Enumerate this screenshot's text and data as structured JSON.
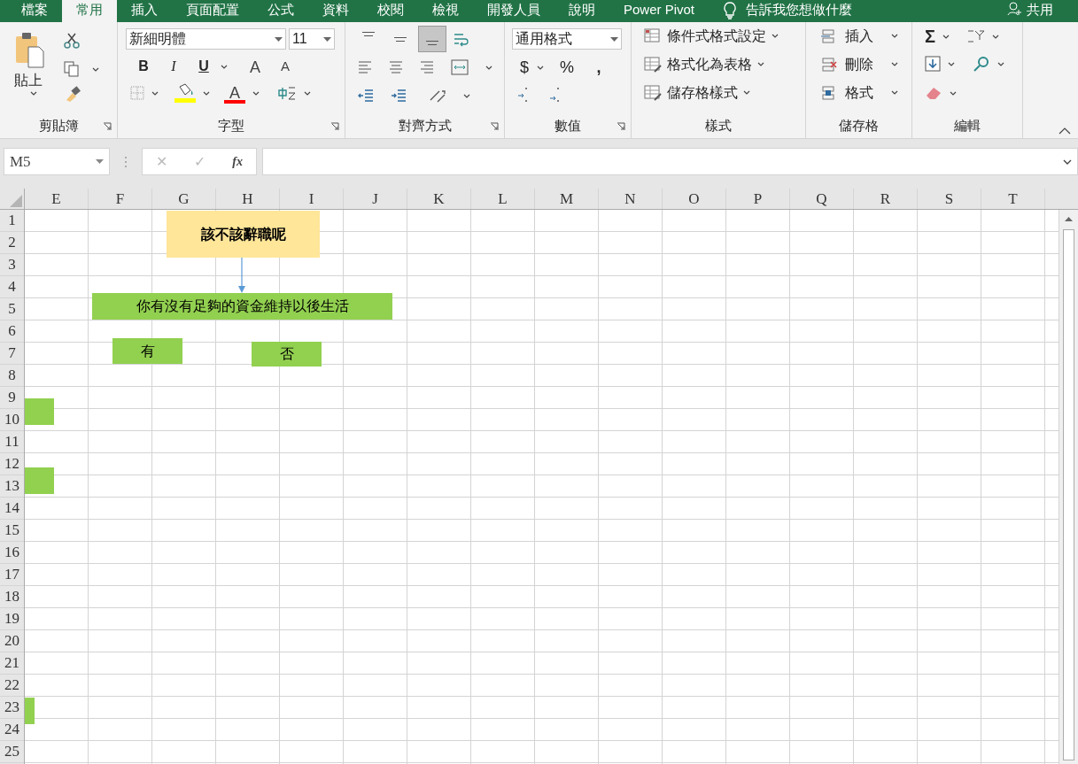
{
  "tabs": [
    {
      "label": "檔案",
      "selected": false
    },
    {
      "label": "常用",
      "selected": true
    },
    {
      "label": "插入",
      "selected": false
    },
    {
      "label": "頁面配置",
      "selected": false
    },
    {
      "label": "公式",
      "selected": false
    },
    {
      "label": "資料",
      "selected": false
    },
    {
      "label": "校閱",
      "selected": false
    },
    {
      "label": "檢視",
      "selected": false
    },
    {
      "label": "開發人員",
      "selected": false
    },
    {
      "label": "說明",
      "selected": false
    },
    {
      "label": "Power Pivot",
      "selected": false
    }
  ],
  "tell_me": "告訴我您想做什麼",
  "share": "共用",
  "ribbon": {
    "clipboard": {
      "paste": "貼上",
      "label": "剪貼簿"
    },
    "font": {
      "name": "新細明體",
      "size": "11",
      "buttons": [
        "B",
        "I",
        "U"
      ],
      "grow": "A",
      "shrink": "A",
      "color_letter": "A",
      "label": "字型"
    },
    "alignment": {
      "vertical": [
        {
          "selected": false
        },
        {
          "selected": false
        },
        {
          "selected": true
        }
      ],
      "label": "對齊方式"
    },
    "number": {
      "format": "通用格式",
      "buttons": [
        "$",
        "%",
        ","
      ],
      "label": "數值"
    },
    "styles": {
      "items": [
        "條件式格式設定",
        "格式化為表格",
        "儲存格樣式"
      ],
      "label": "樣式"
    },
    "cells": {
      "items": [
        "插入",
        "刪除",
        "格式"
      ],
      "label": "儲存格"
    },
    "editing": {
      "sum": "Σ",
      "label": "編輯"
    }
  },
  "formula_bar": {
    "name_box": "M5",
    "cancel": "✕",
    "enter": "✓",
    "fx": "fx"
  },
  "sheet": {
    "columns": [
      "E",
      "F",
      "G",
      "H",
      "I",
      "J",
      "K",
      "L",
      "M",
      "N",
      "O",
      "P",
      "Q",
      "R",
      "S",
      "T"
    ],
    "rows": [
      "1",
      "2",
      "3",
      "4",
      "5",
      "6",
      "7",
      "8",
      "9",
      "10",
      "11",
      "12",
      "13",
      "14",
      "15",
      "16",
      "17",
      "18",
      "19",
      "20",
      "21",
      "22",
      "23",
      "24",
      "25"
    ],
    "shapes": [
      {
        "kind": "box",
        "text": "該不該辭職呢",
        "bold": true,
        "color": "#ffe699"
      },
      {
        "kind": "arrow"
      },
      {
        "kind": "box",
        "text": "你有沒有足夠的資金維持以後生活",
        "bold": false,
        "color": "#92d050"
      },
      {
        "kind": "box",
        "text": "有",
        "bold": false,
        "color": "#92d050"
      },
      {
        "kind": "box",
        "text": "否",
        "bold": false,
        "color": "#92d050"
      },
      {
        "kind": "box",
        "color": "#92d050"
      },
      {
        "kind": "box",
        "color": "#92d050"
      },
      {
        "kind": "box",
        "color": "#92d050"
      }
    ]
  }
}
